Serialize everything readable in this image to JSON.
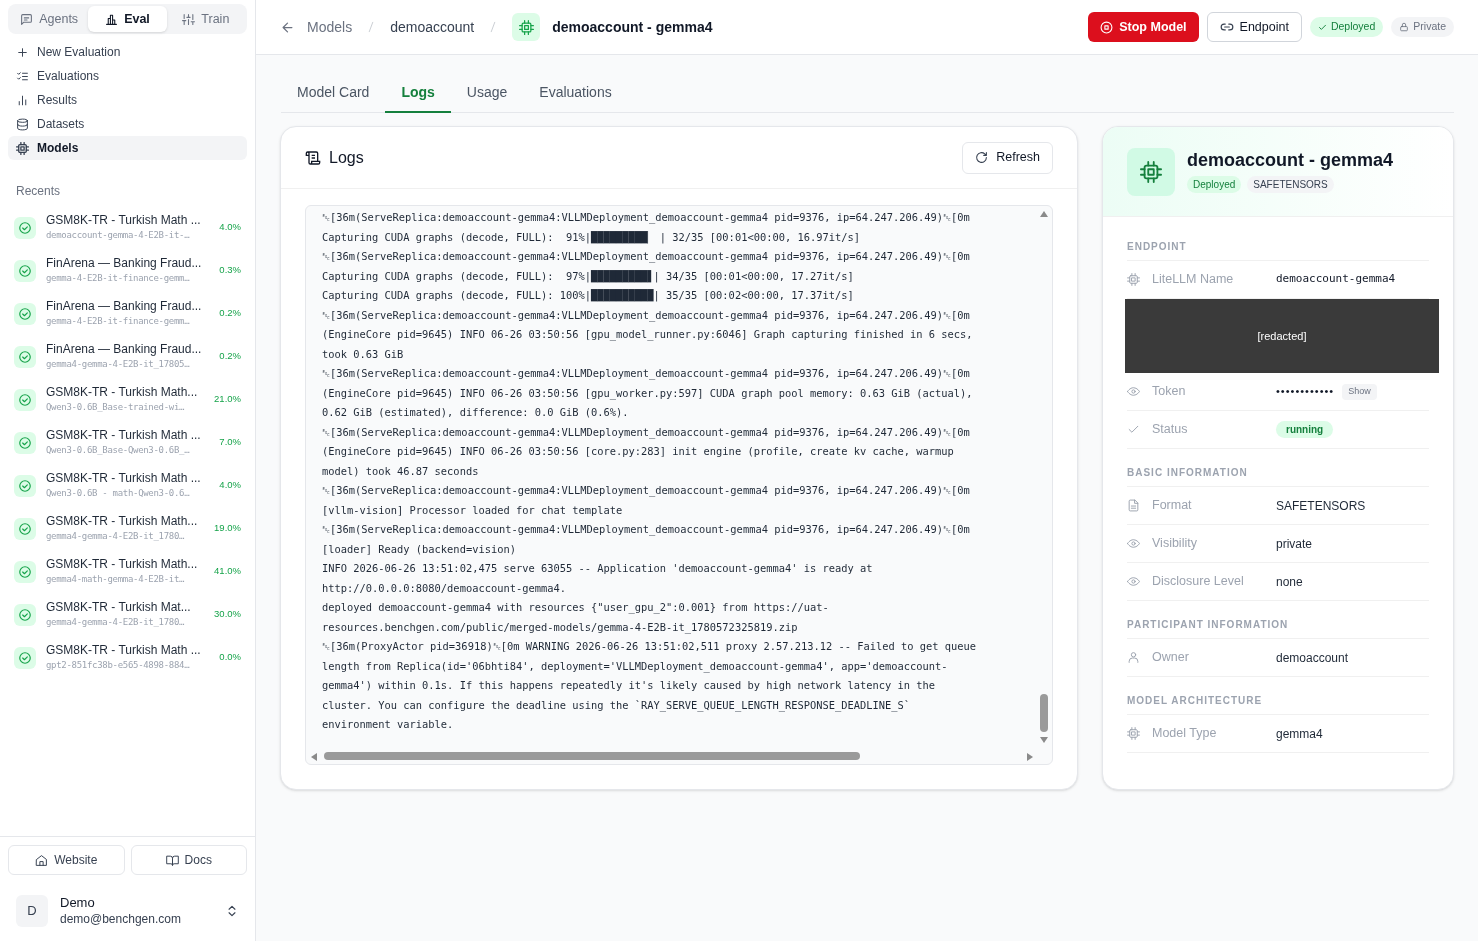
{
  "mode_tabs": [
    {
      "label": "Agents",
      "selected": false
    },
    {
      "label": "Eval",
      "selected": true
    },
    {
      "label": "Train",
      "selected": false
    }
  ],
  "nav": [
    {
      "label": "New Evaluation",
      "selected": false
    },
    {
      "label": "Evaluations",
      "selected": false
    },
    {
      "label": "Results",
      "selected": false
    },
    {
      "label": "Datasets",
      "selected": false
    },
    {
      "label": "Models",
      "selected": true
    }
  ],
  "recents": {
    "title": "Recents",
    "items": [
      {
        "title": "GSM8K-TR - Turkish Math ...",
        "subtitle": "demoaccount-gemma-4-E2B-it-…",
        "score": "4.0%"
      },
      {
        "title": "FinArena — Banking Fraud...",
        "subtitle": "gemma-4-E2B-it-finance-gemm…",
        "score": "0.3%"
      },
      {
        "title": "FinArena — Banking Fraud...",
        "subtitle": "gemma-4-E2B-it-finance-gemm…",
        "score": "0.2%"
      },
      {
        "title": "FinArena — Banking Fraud...",
        "subtitle": "gemma4-gemma-4-E2B-it_17805…",
        "score": "0.2%"
      },
      {
        "title": "GSM8K-TR - Turkish Math...",
        "subtitle": "Qwen3-0.6B_Base-trained-wi…",
        "score": "21.0%"
      },
      {
        "title": "GSM8K-TR - Turkish Math ...",
        "subtitle": "Qwen3-0.6B_Base-Qwen3-0.6B_…",
        "score": "7.0%"
      },
      {
        "title": "GSM8K-TR - Turkish Math ...",
        "subtitle": "Qwen3-0.6B - math-Qwen3-0.6…",
        "score": "4.0%"
      },
      {
        "title": "GSM8K-TR - Turkish Math...",
        "subtitle": "gemma4-gemma-4-E2B-it_1780…",
        "score": "19.0%"
      },
      {
        "title": "GSM8K-TR - Turkish Math...",
        "subtitle": "gemma4-math-gemma-4-E2B-it…",
        "score": "41.0%"
      },
      {
        "title": "GSM8K-TR - Turkish Mat...",
        "subtitle": "gemma4-gemma-4-E2B-it_1780…",
        "score": "30.0%"
      },
      {
        "title": "GSM8K-TR - Turkish Math ...",
        "subtitle": "gpt2-851fc38b-e565-4898-884…",
        "score": "0.0%"
      }
    ]
  },
  "footer_links": [
    "Website",
    "Docs"
  ],
  "user": {
    "initial": "D",
    "name": "Demo",
    "email": "demo@benchgen.com"
  },
  "breadcrumb": [
    "Models",
    "demoaccount",
    "demoaccount - gemma4"
  ],
  "header_actions": {
    "stop": "Stop Model",
    "endpoint": "Endpoint",
    "status": "Deployed",
    "visibility": "Private"
  },
  "tabs": [
    {
      "label": "Model Card",
      "selected": false
    },
    {
      "label": "Logs",
      "selected": true
    },
    {
      "label": "Usage",
      "selected": false
    },
    {
      "label": "Evaluations",
      "selected": false
    }
  ],
  "logs": {
    "title": "Logs",
    "refresh": "Refresh",
    "lines": [
      "␛[36m(ServeReplica:demoaccount-gemma4:VLLMDeployment_demoaccount-gemma4 pid=9376, ip=64.247.206.49)␛[0m",
      "Capturing CUDA graphs (decode, FULL):  91%|█████████▏ | 32/35 [00:01<00:00, 16.97it/s]",
      "␛[36m(ServeReplica:demoaccount-gemma4:VLLMDeployment_demoaccount-gemma4 pid=9376, ip=64.247.206.49)␛[0m",
      "Capturing CUDA graphs (decode, FULL):  97%|█████████▋| 34/35 [00:01<00:00, 17.27it/s]",
      "Capturing CUDA graphs (decode, FULL): 100%|██████████| 35/35 [00:02<00:00, 17.37it/s]",
      "␛[36m(ServeReplica:demoaccount-gemma4:VLLMDeployment_demoaccount-gemma4 pid=9376, ip=64.247.206.49)␛[0m",
      "(EngineCore pid=9645) INFO 06-26 03:50:56 [gpu_model_runner.py:6046] Graph capturing finished in 6 secs,",
      "took 0.63 GiB",
      "␛[36m(ServeReplica:demoaccount-gemma4:VLLMDeployment_demoaccount-gemma4 pid=9376, ip=64.247.206.49)␛[0m",
      "(EngineCore pid=9645) INFO 06-26 03:50:56 [gpu_worker.py:597] CUDA graph pool memory: 0.63 GiB (actual),",
      "0.62 GiB (estimated), difference: 0.0 GiB (0.6%).",
      "␛[36m(ServeReplica:demoaccount-gemma4:VLLMDeployment_demoaccount-gemma4 pid=9376, ip=64.247.206.49)␛[0m",
      "(EngineCore pid=9645) INFO 06-26 03:50:56 [core.py:283] init engine (profile, create kv cache, warmup",
      "model) took 46.87 seconds",
      "␛[36m(ServeReplica:demoaccount-gemma4:VLLMDeployment_demoaccount-gemma4 pid=9376, ip=64.247.206.49)␛[0m",
      "[vllm-vision] Processor loaded for chat template",
      "␛[36m(ServeReplica:demoaccount-gemma4:VLLMDeployment_demoaccount-gemma4 pid=9376, ip=64.247.206.49)␛[0m",
      "[loader] Ready (backend=vision)",
      "INFO 2026-06-26 13:51:02,475 serve 63055 -- Application 'demoaccount-gemma4' is ready at",
      "http://0.0.0.0:8080/demoaccount-gemma4.",
      "deployed demoaccount-gemma4 with resources {\"user_gpu_2\":0.001} from https://uat-",
      "resources.benchgen.com/public/merged-models/gemma-4-E2B-it_1780572325819.zip",
      "␛[36m(ProxyActor pid=36918)␛[0m WARNING 2026-06-26 13:51:02,511 proxy 2.57.213.12 -- Failed to get queue",
      "length from Replica(id='06bhti84', deployment='VLLMDeployment_demoaccount-gemma4', app='demoaccount-",
      "gemma4') within 0.1s. If this happens repeatedly it's likely caused by high network latency in the",
      "cluster. You can configure the deadline using the `RAY_SERVE_QUEUE_LENGTH_RESPONSE_DEADLINE_S`",
      "environment variable."
    ]
  },
  "model_card": {
    "title": "demoaccount - gemma4",
    "badges": [
      "Deployed",
      "SAFETENSORS"
    ],
    "sections": [
      {
        "title": "ENDPOINT",
        "rows": [
          {
            "kind": "mono",
            "label": "LiteLLM Name",
            "value": "demoaccount-gemma4"
          },
          {
            "kind": "redacted",
            "value": "[redacted]"
          },
          {
            "kind": "secret",
            "label": "Token",
            "value": "••••••••••••",
            "action": "Show"
          },
          {
            "kind": "badge",
            "label": "Status",
            "value": "running"
          }
        ]
      },
      {
        "title": "BASIC INFORMATION",
        "rows": [
          {
            "kind": "plain",
            "label": "Format",
            "value": "SAFETENSORS"
          },
          {
            "kind": "plain",
            "label": "Visibility",
            "value": "private"
          },
          {
            "kind": "plain",
            "label": "Disclosure Level",
            "value": "none"
          }
        ]
      },
      {
        "title": "PARTICIPANT INFORMATION",
        "rows": [
          {
            "kind": "plain",
            "label": "Owner",
            "value": "demoaccount"
          }
        ]
      },
      {
        "title": "MODEL ARCHITECTURE",
        "rows": [
          {
            "kind": "plain",
            "label": "Model Type",
            "value": "gemma4"
          }
        ]
      }
    ]
  }
}
